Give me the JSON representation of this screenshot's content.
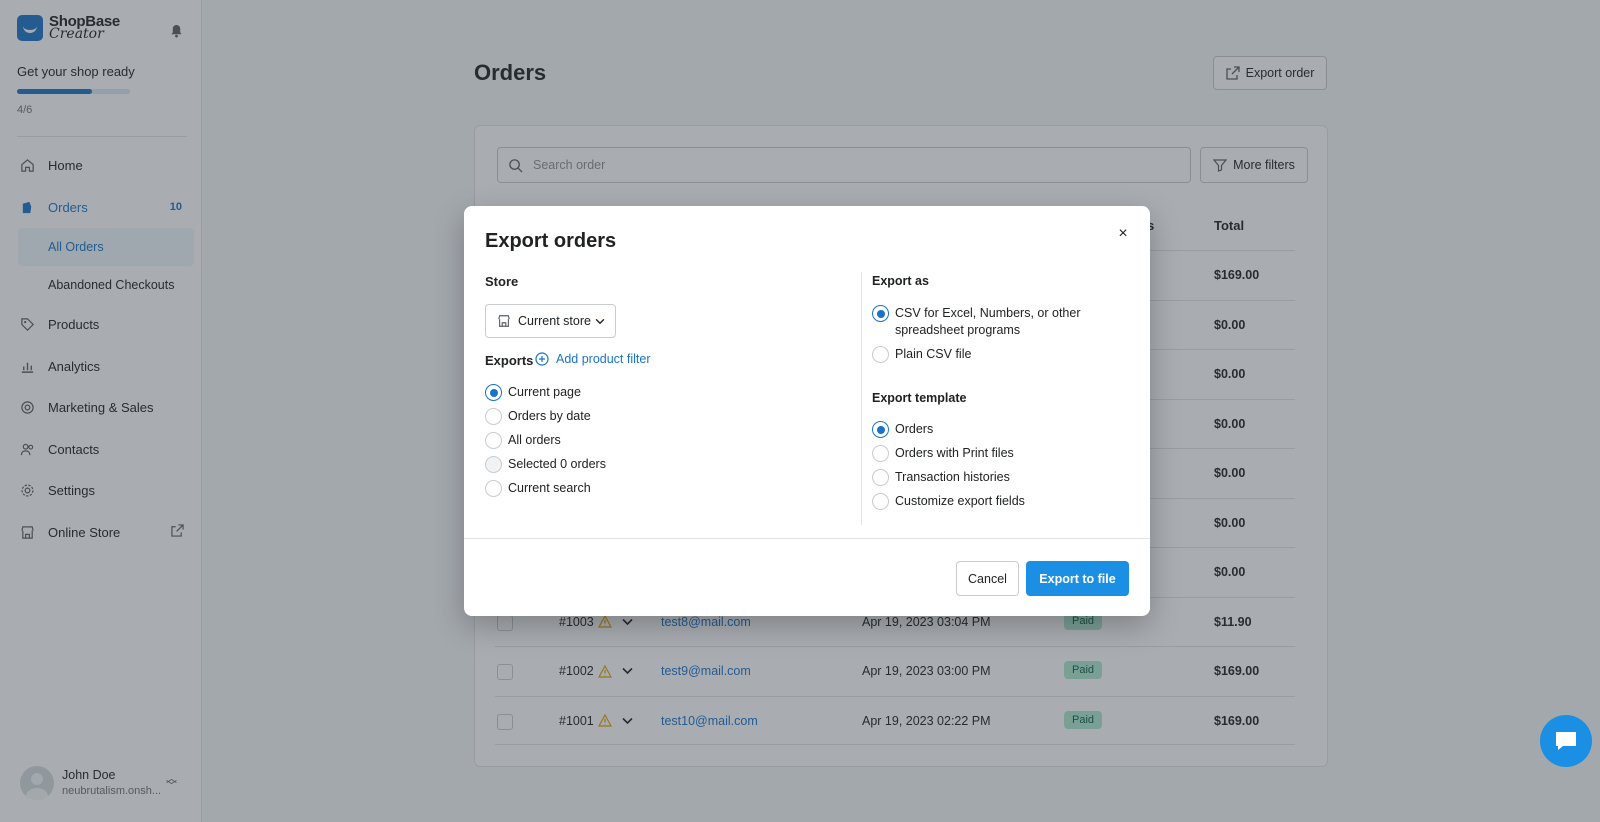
{
  "brand": {
    "line1": "ShopBase",
    "line2": "Creator"
  },
  "onboarding": {
    "title": "Get your shop ready",
    "progress_text": "4/6",
    "progress": 0.6667
  },
  "sidebar": {
    "items": [
      {
        "label": "Home",
        "icon": "home-icon"
      },
      {
        "label": "Orders",
        "icon": "orders-icon",
        "badge": "10"
      },
      {
        "label": "All Orders"
      },
      {
        "label": "Abandoned Checkouts"
      },
      {
        "label": "Products",
        "icon": "tag-icon"
      },
      {
        "label": "Analytics",
        "icon": "analytics-icon"
      },
      {
        "label": "Marketing & Sales",
        "icon": "target-icon"
      },
      {
        "label": "Contacts",
        "icon": "contacts-icon"
      },
      {
        "label": "Settings",
        "icon": "gear-icon"
      },
      {
        "label": "Online Store",
        "icon": "store-icon"
      }
    ]
  },
  "user": {
    "name": "John Doe",
    "shop": "neubrutalism.onsh..."
  },
  "page": {
    "title": "Orders",
    "export_button": "Export order"
  },
  "table": {
    "search_placeholder": "Search order",
    "more_filters": "More filters",
    "status_header_fragment": "s",
    "total_header": "Total",
    "rows": [
      {
        "total": "$169.00"
      },
      {
        "total": "$0.00"
      },
      {
        "total": "$0.00"
      },
      {
        "total": "$0.00"
      },
      {
        "total": "$0.00"
      },
      {
        "total": "$0.00"
      },
      {
        "total": "$0.00"
      },
      {
        "id": "#1003",
        "email": "test8@mail.com",
        "date": "Apr 19, 2023 03:04 PM",
        "status": "Paid",
        "total": "$11.90"
      },
      {
        "id": "#1002",
        "email": "test9@mail.com",
        "date": "Apr 19, 2023 03:00 PM",
        "status": "Paid",
        "total": "$169.00"
      },
      {
        "id": "#1001",
        "email": "test10@mail.com",
        "date": "Apr 19, 2023 02:22 PM",
        "status": "Paid",
        "total": "$169.00"
      }
    ]
  },
  "modal": {
    "title": "Export orders",
    "close": "×",
    "store_label": "Store",
    "store_value": "Current store",
    "exports_label": "Exports",
    "add_filter": "Add product filter",
    "exports_options": [
      {
        "label": "Current page",
        "checked": true
      },
      {
        "label": "Orders by date",
        "checked": false
      },
      {
        "label": "All orders",
        "checked": false
      },
      {
        "label": "Selected 0 orders",
        "checked": false,
        "disabled": true
      },
      {
        "label": "Current search",
        "checked": false
      }
    ],
    "export_as_label": "Export as",
    "export_as_options": [
      {
        "label": "CSV for Excel, Numbers, or other spreadsheet programs",
        "checked": true
      },
      {
        "label": "Plain CSV file",
        "checked": false
      }
    ],
    "template_label": "Export template",
    "template_options": [
      {
        "label": "Orders",
        "checked": true
      },
      {
        "label": "Orders with Print files",
        "checked": false
      },
      {
        "label": "Transaction histories",
        "checked": false
      },
      {
        "label": "Customize export fields",
        "checked": false
      }
    ],
    "cancel": "Cancel",
    "export": "Export to file"
  },
  "colors": {
    "accent": "#1a73c8",
    "primary_button": "#1a8fe3",
    "paid_badge": "#aee9d1"
  }
}
